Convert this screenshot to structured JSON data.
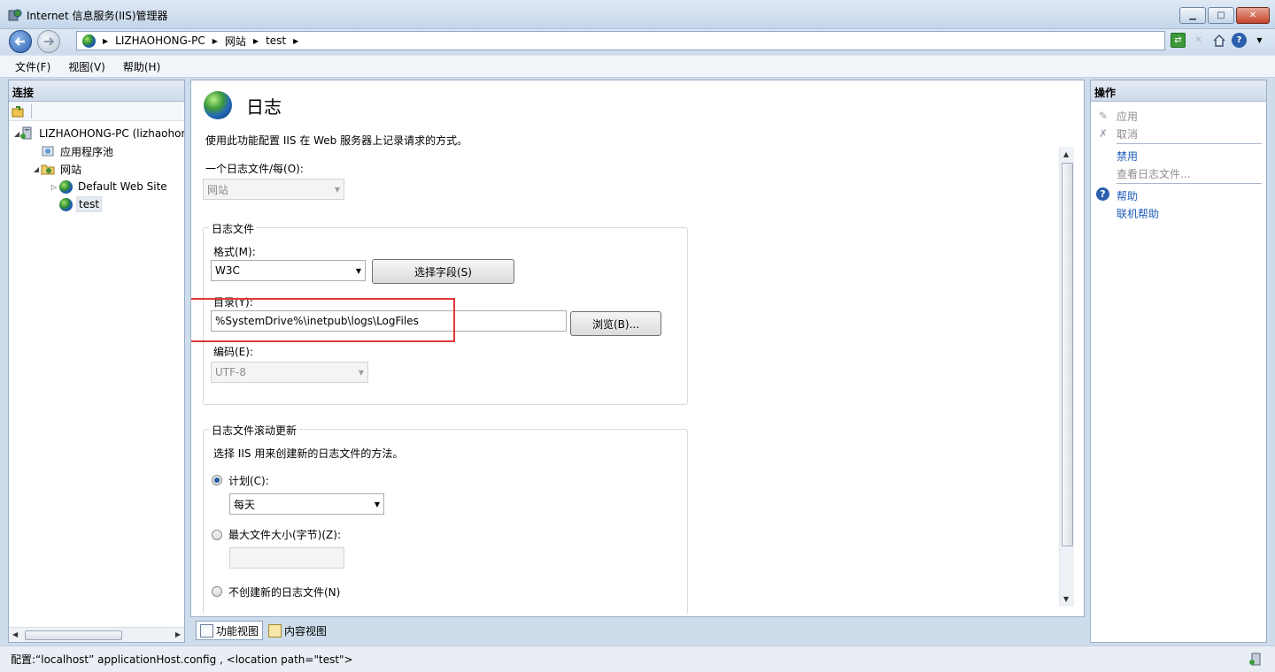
{
  "window": {
    "title": "Internet 信息服务(IIS)管理器",
    "minimize_symbol": "▁",
    "maximize_symbol": "□",
    "close_symbol": "✕"
  },
  "address": {
    "crumbs": [
      "LIZHAOHONG-PC",
      "网站",
      "test"
    ],
    "separator": "▶"
  },
  "menu": [
    "文件(F)",
    "视图(V)",
    "帮助(H)"
  ],
  "connections": {
    "header": "连接",
    "tree": [
      {
        "label": "LIZHAOHONG-PC (lizhaohong-PC\\lizhaohong)",
        "expander": "◢",
        "icon": "server-icon"
      },
      {
        "label": "应用程序池",
        "expander": "",
        "icon": "app-pool-icon"
      },
      {
        "label": "网站",
        "expander": "◢",
        "icon": "sites-folder-icon"
      },
      {
        "label": "Default Web Site",
        "expander": "▷",
        "icon": "website-icon"
      },
      {
        "label": "test",
        "expander": "",
        "icon": "website-icon"
      }
    ]
  },
  "main": {
    "title": "日志",
    "description": "使用此功能配置 IIS 在 Web 服务器上记录请求的方式。",
    "one_log_per_label": "一个日志文件/每(O):",
    "one_log_per_value": "网站",
    "log_file_group": "日志文件",
    "format_label": "格式(M):",
    "format_value": "W3C",
    "select_fields_button": "选择字段(S)",
    "directory_label": "目录(Y):",
    "directory_value": "%SystemDrive%\\inetpub\\logs\\LogFiles",
    "browse_button": "浏览(B)...",
    "encoding_label": "编码(E):",
    "encoding_value": "UTF-8",
    "rollover_group": "日志文件滚动更新",
    "rollover_desc": "选择 IIS 用来创建新的日志文件的方法。",
    "schedule_label": "计划(C):",
    "schedule_value": "每天",
    "max_size_label": "最大文件大小(字节)(Z):",
    "max_size_value": "",
    "no_new_label": "不创建新的日志文件(N)"
  },
  "view_tabs": [
    "功能视图",
    "内容视图"
  ],
  "actions": {
    "header": "操作",
    "apply": "应用",
    "cancel": "取消",
    "disable": "禁用",
    "view_logs": "查看日志文件...",
    "help": "帮助",
    "online_help": "联机帮助"
  },
  "status": {
    "text": "配置:“localhost”  applicationHost.config , <location path=\"test\">"
  },
  "colors": {
    "highlight": "#e2383a",
    "link": "#1f5bb8"
  }
}
